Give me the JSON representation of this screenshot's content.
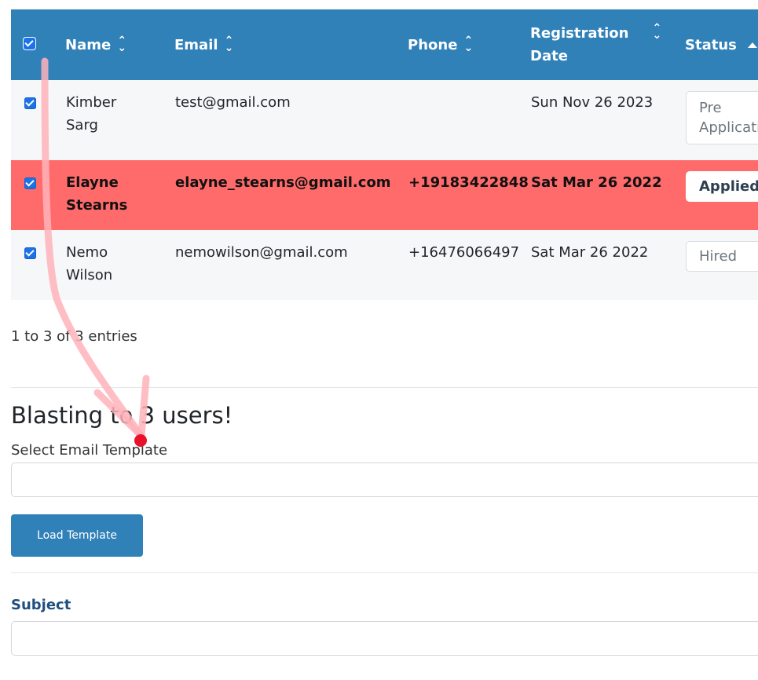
{
  "table": {
    "headers": {
      "name": "Name",
      "email": "Email",
      "phone": "Phone",
      "registration_line1": "Registration",
      "registration_line2": "Date",
      "status": "Status"
    },
    "rows": [
      {
        "name_line1": "Kimber",
        "name_line2": "Sarg",
        "email": "test@gmail.com",
        "phone": "",
        "registration": "Sun Nov 26 2023",
        "status_line1": "Pre",
        "status_line2": "Application",
        "checked": true
      },
      {
        "name_line1": "Elayne",
        "name_line2": "Stearns",
        "email": "elayne_stearns@gmail.com",
        "phone": "+19183422848",
        "registration": "Sat Mar 26 2022",
        "status_line1": "Applied",
        "checked": true,
        "highlighted": true
      },
      {
        "name_line1": "Nemo",
        "name_line2": "Wilson",
        "email": "nemowilson@gmail.com",
        "phone": "+16476066497",
        "registration": "Sat Mar 26 2022",
        "status_line1": "Hired",
        "checked": true
      }
    ]
  },
  "pagination": {
    "entries_text": "1 to 3 of 3 entries"
  },
  "blast": {
    "title": "Blasting to 3 users!",
    "template_label": "Select Email Template",
    "template_value": "",
    "load_button": "Load Template",
    "subject_label": "Subject",
    "subject_value": ""
  },
  "colors": {
    "header_bg": "#3181b9",
    "highlight_row": "#ff6b6b",
    "annotation_arrow": "#ff9fa8",
    "annotation_dot": "#e8122a"
  }
}
